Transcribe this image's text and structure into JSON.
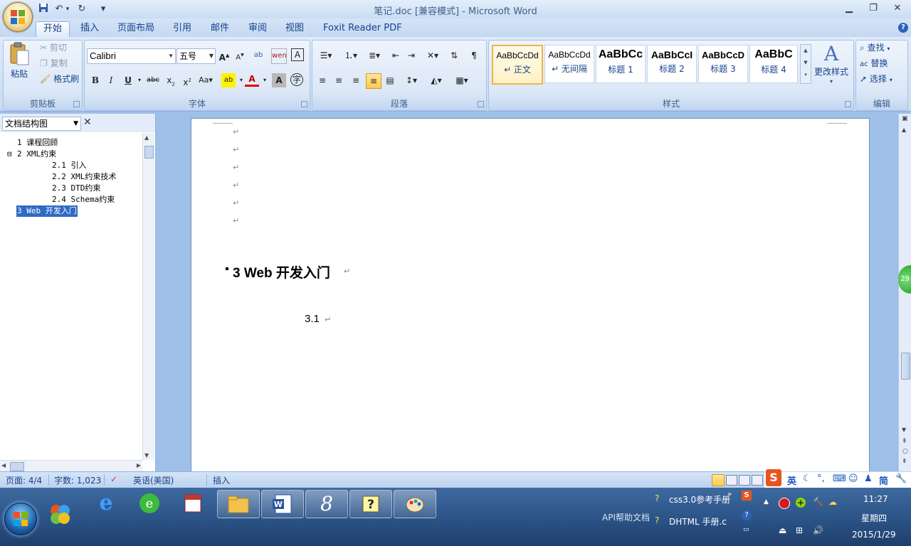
{
  "window": {
    "title": "笔记.doc [兼容模式] - Microsoft Word",
    "qat_more": "▾"
  },
  "tabs": [
    "开始",
    "插入",
    "页面布局",
    "引用",
    "邮件",
    "审阅",
    "视图",
    "Foxit Reader PDF"
  ],
  "ribbon": {
    "clipboard": {
      "label": "剪贴板",
      "paste": "粘贴",
      "cut": "剪切",
      "copy": "复制",
      "format_painter": "格式刷"
    },
    "font": {
      "label": "字体",
      "name": "Calibri",
      "size": "五号"
    },
    "paragraph": {
      "label": "段落"
    },
    "styles": {
      "label": "样式",
      "items": [
        {
          "preview": "AaBbCcDd",
          "name": "↵ 正文"
        },
        {
          "preview": "AaBbCcDd",
          "name": "↵ 无间隔"
        },
        {
          "preview": "AaBbCc",
          "name": "标题 1"
        },
        {
          "preview": "AaBbCcI",
          "name": "标题 2"
        },
        {
          "preview": "AaBbCcD",
          "name": "标题 3"
        },
        {
          "preview": "AaBbC",
          "name": "标题 4"
        }
      ],
      "change_styles": "更改样式"
    },
    "editing": {
      "label": "编辑",
      "find": "查找",
      "replace": "替换",
      "select": "选择"
    }
  },
  "nav": {
    "dropdown": "文档结构图",
    "items": [
      {
        "text": "1 课程回顾"
      },
      {
        "text": "2 XML约束"
      },
      {
        "text": "2.1 引入"
      },
      {
        "text": "2.2 XML约束技术"
      },
      {
        "text": "2.3 DTD约束"
      },
      {
        "text": "2.4 Schema约束"
      },
      {
        "text": "3 Web 开发入门"
      }
    ],
    "collapse_glyph": "⊟"
  },
  "document": {
    "paragraph_mark": "↵",
    "heading": "3 Web 开发入门",
    "subheading": "3.1"
  },
  "status_bar": {
    "page": "页面: 4/4",
    "words": "字数: 1,023",
    "language": "英语(美国)",
    "mode": "插入",
    "ime_lang": "英",
    "ime_simplified": "简"
  },
  "taskbar": {
    "tray": {
      "css_manual": "css3.0参考手册",
      "api_docs": "API帮助文档",
      "dhtml": "DHTML 手册.c",
      "time": "11:27",
      "weekday": "星期四",
      "date": "2015/1/29"
    }
  },
  "side_bubble": "29"
}
